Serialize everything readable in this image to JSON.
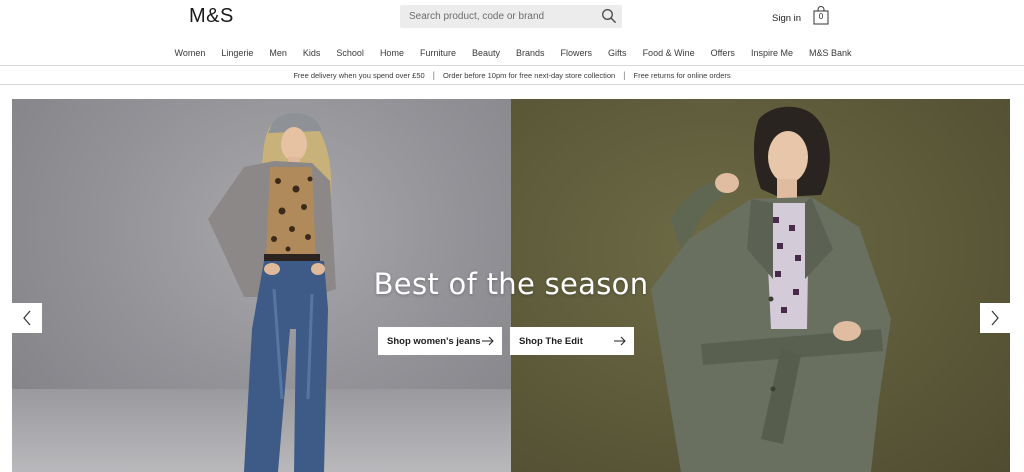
{
  "header": {
    "logo": "M&S",
    "search_placeholder": "Search product, code or brand",
    "signin": "Sign in",
    "bag_count": "0"
  },
  "nav": {
    "items": [
      "Women",
      "Lingerie",
      "Men",
      "Kids",
      "School",
      "Home",
      "Furniture",
      "Beauty",
      "Brands",
      "Flowers",
      "Gifts",
      "Food & Wine",
      "Offers",
      "Inspire Me",
      "M&S Bank"
    ]
  },
  "promo": {
    "items": [
      "Free delivery when you spend over £50",
      "Order before 10pm for free next-day store collection",
      "Free returns for online orders"
    ],
    "separator": "|"
  },
  "hero": {
    "title": "Best of the season",
    "cta_jeans": "Shop women's jeans",
    "cta_edit": "Shop The Edit"
  },
  "colors": {
    "hero_left_bg": "#939398",
    "hero_right_bg": "#5d5a3a",
    "search_bg": "#ececec"
  }
}
